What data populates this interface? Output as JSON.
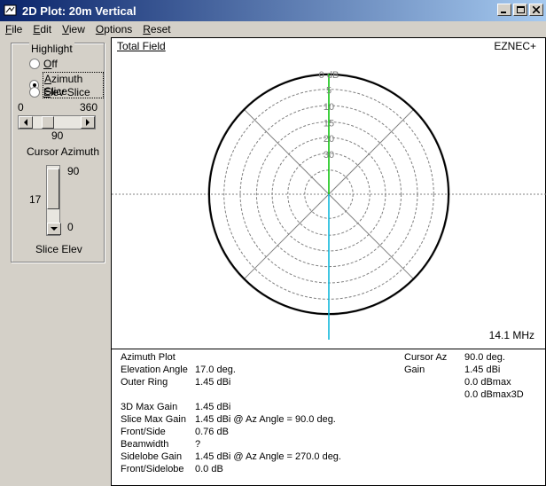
{
  "window": {
    "title": "2D Plot: 20m Vertical"
  },
  "menu": {
    "items": [
      {
        "key": "F",
        "rest": "ile"
      },
      {
        "key": "E",
        "rest": "dit"
      },
      {
        "key": "V",
        "rest": "iew"
      },
      {
        "key": "O",
        "rest": "ptions"
      },
      {
        "key": "R",
        "rest": "eset"
      }
    ]
  },
  "highlight": {
    "title": "Highlight",
    "options": [
      {
        "key": "O",
        "rest": "ff",
        "checked": false
      },
      {
        "key": "A",
        "rest": "zimuth Slice",
        "checked": true
      },
      {
        "key": "E",
        "rest": "lev Slice",
        "checked": false
      }
    ],
    "azimuth": {
      "min": "0",
      "max": "360",
      "value": "90",
      "label": "Cursor Azimuth",
      "fraction": 0.25
    },
    "elevation": {
      "max": "90",
      "min": "0",
      "value": "17",
      "label": "Slice Elev",
      "fraction": 0.19
    }
  },
  "plot": {
    "title": "Total Field",
    "brand": "EZNEC+",
    "frequency": "14.1 MHz",
    "ring_labels": [
      "0 dB",
      "5",
      "10",
      "15",
      "20",
      "30"
    ],
    "colors": {
      "pattern": "#000000",
      "grid": "#808080",
      "cursor_upper": "#00c000",
      "cursor_lower": "#00b4d8"
    }
  },
  "info": {
    "plot_type": "Azimuth Plot",
    "rows": [
      {
        "label": "Elevation Angle",
        "value": "17.0 deg."
      },
      {
        "label": "Outer Ring",
        "value": "1.45 dBi"
      },
      {
        "label": "3D Max Gain",
        "value": "1.45 dBi"
      },
      {
        "label": "Slice Max Gain",
        "value": "1.45 dBi @ Az Angle = 90.0 deg."
      },
      {
        "label": "Front/Side",
        "value": "0.76 dB"
      },
      {
        "label": "Beamwidth",
        "value": "?"
      },
      {
        "label": "Sidelobe Gain",
        "value": "1.45 dBi @ Az Angle = 270.0 deg."
      },
      {
        "label": "Front/Sidelobe",
        "value": "0.0 dB"
      }
    ],
    "cursor": {
      "az_label": "Cursor Az",
      "az_value": "90.0 deg.",
      "gain_label": "Gain",
      "gain_values": [
        "1.45 dBi",
        "0.0 dBmax",
        "0.0 dBmax3D"
      ]
    }
  }
}
